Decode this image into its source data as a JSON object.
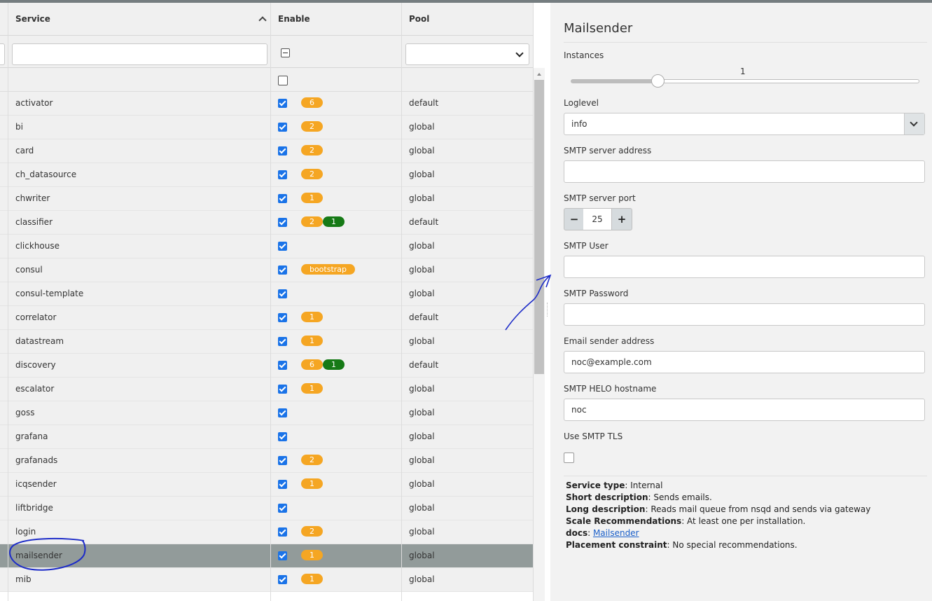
{
  "grid": {
    "headers": {
      "service": "Service",
      "enable": "Enable",
      "pool": "Pool"
    },
    "rows": [
      {
        "service": "activator",
        "badges": [
          {
            "text": "6",
            "color": "orange"
          }
        ],
        "pool": "default"
      },
      {
        "service": "bi",
        "badges": [
          {
            "text": "2",
            "color": "orange"
          }
        ],
        "pool": "global"
      },
      {
        "service": "card",
        "badges": [
          {
            "text": "2",
            "color": "orange"
          }
        ],
        "pool": "global"
      },
      {
        "service": "ch_datasource",
        "badges": [
          {
            "text": "2",
            "color": "orange"
          }
        ],
        "pool": "global"
      },
      {
        "service": "chwriter",
        "badges": [
          {
            "text": "1",
            "color": "orange"
          }
        ],
        "pool": "global"
      },
      {
        "service": "classifier",
        "badges": [
          {
            "text": "2",
            "color": "orange"
          },
          {
            "text": "1",
            "color": "green"
          }
        ],
        "pool": "default"
      },
      {
        "service": "clickhouse",
        "badges": [],
        "pool": "global"
      },
      {
        "service": "consul",
        "badges": [
          {
            "text": "bootstrap",
            "color": "orange"
          }
        ],
        "pool": "global"
      },
      {
        "service": "consul-template",
        "badges": [],
        "pool": "global"
      },
      {
        "service": "correlator",
        "badges": [
          {
            "text": "1",
            "color": "orange"
          }
        ],
        "pool": "default"
      },
      {
        "service": "datastream",
        "badges": [
          {
            "text": "1",
            "color": "orange"
          }
        ],
        "pool": "global"
      },
      {
        "service": "discovery",
        "badges": [
          {
            "text": "6",
            "color": "orange"
          },
          {
            "text": "1",
            "color": "green"
          }
        ],
        "pool": "default"
      },
      {
        "service": "escalator",
        "badges": [
          {
            "text": "1",
            "color": "orange"
          }
        ],
        "pool": "global"
      },
      {
        "service": "goss",
        "badges": [],
        "pool": "global"
      },
      {
        "service": "grafana",
        "badges": [],
        "pool": "global"
      },
      {
        "service": "grafanads",
        "badges": [
          {
            "text": "2",
            "color": "orange"
          }
        ],
        "pool": "global"
      },
      {
        "service": "icqsender",
        "badges": [
          {
            "text": "1",
            "color": "orange"
          }
        ],
        "pool": "global"
      },
      {
        "service": "liftbridge",
        "badges": [],
        "pool": "global"
      },
      {
        "service": "login",
        "badges": [
          {
            "text": "2",
            "color": "orange"
          }
        ],
        "pool": "global"
      },
      {
        "service": "mailsender",
        "badges": [
          {
            "text": "1",
            "color": "orange"
          }
        ],
        "pool": "global",
        "selected": true
      },
      {
        "service": "mib",
        "badges": [
          {
            "text": "1",
            "color": "orange"
          }
        ],
        "pool": "global"
      }
    ]
  },
  "panel": {
    "title": "Mailsender",
    "instances_label": "Instances",
    "instances_value": "1",
    "instances_fraction": 0.25,
    "loglevel_label": "Loglevel",
    "loglevel_value": "info",
    "smtp_address_label": "SMTP server address",
    "smtp_address_value": "",
    "smtp_port_label": "SMTP server port",
    "smtp_port_value": "25",
    "smtp_user_label": "SMTP User",
    "smtp_user_value": "",
    "smtp_password_label": "SMTP Password",
    "smtp_password_value": "",
    "email_sender_label": "Email sender address",
    "email_sender_value": "noc@example.com",
    "helo_label": "SMTP HELO hostname",
    "helo_value": "noc",
    "tls_label": "Use SMTP TLS",
    "info": {
      "service_type_label": "Service type",
      "service_type": "Internal",
      "short_desc_label": "Short description",
      "short_desc": "Sends emails.",
      "long_desc_label": "Long description",
      "long_desc": "Reads mail queue from nsqd and sends via gateway",
      "scale_label": "Scale Recommendations",
      "scale": "At least one per installation.",
      "docs_label": "docs",
      "docs_link": "Mailsender",
      "placement_label": "Placement constraint",
      "placement": "No special recommendations."
    }
  },
  "colors": {
    "accent": "#1a73e8",
    "badge_orange": "#f5a623",
    "badge_green": "#167a16",
    "selected_row": "#929b9a",
    "annotation": "#1c2bc8"
  }
}
